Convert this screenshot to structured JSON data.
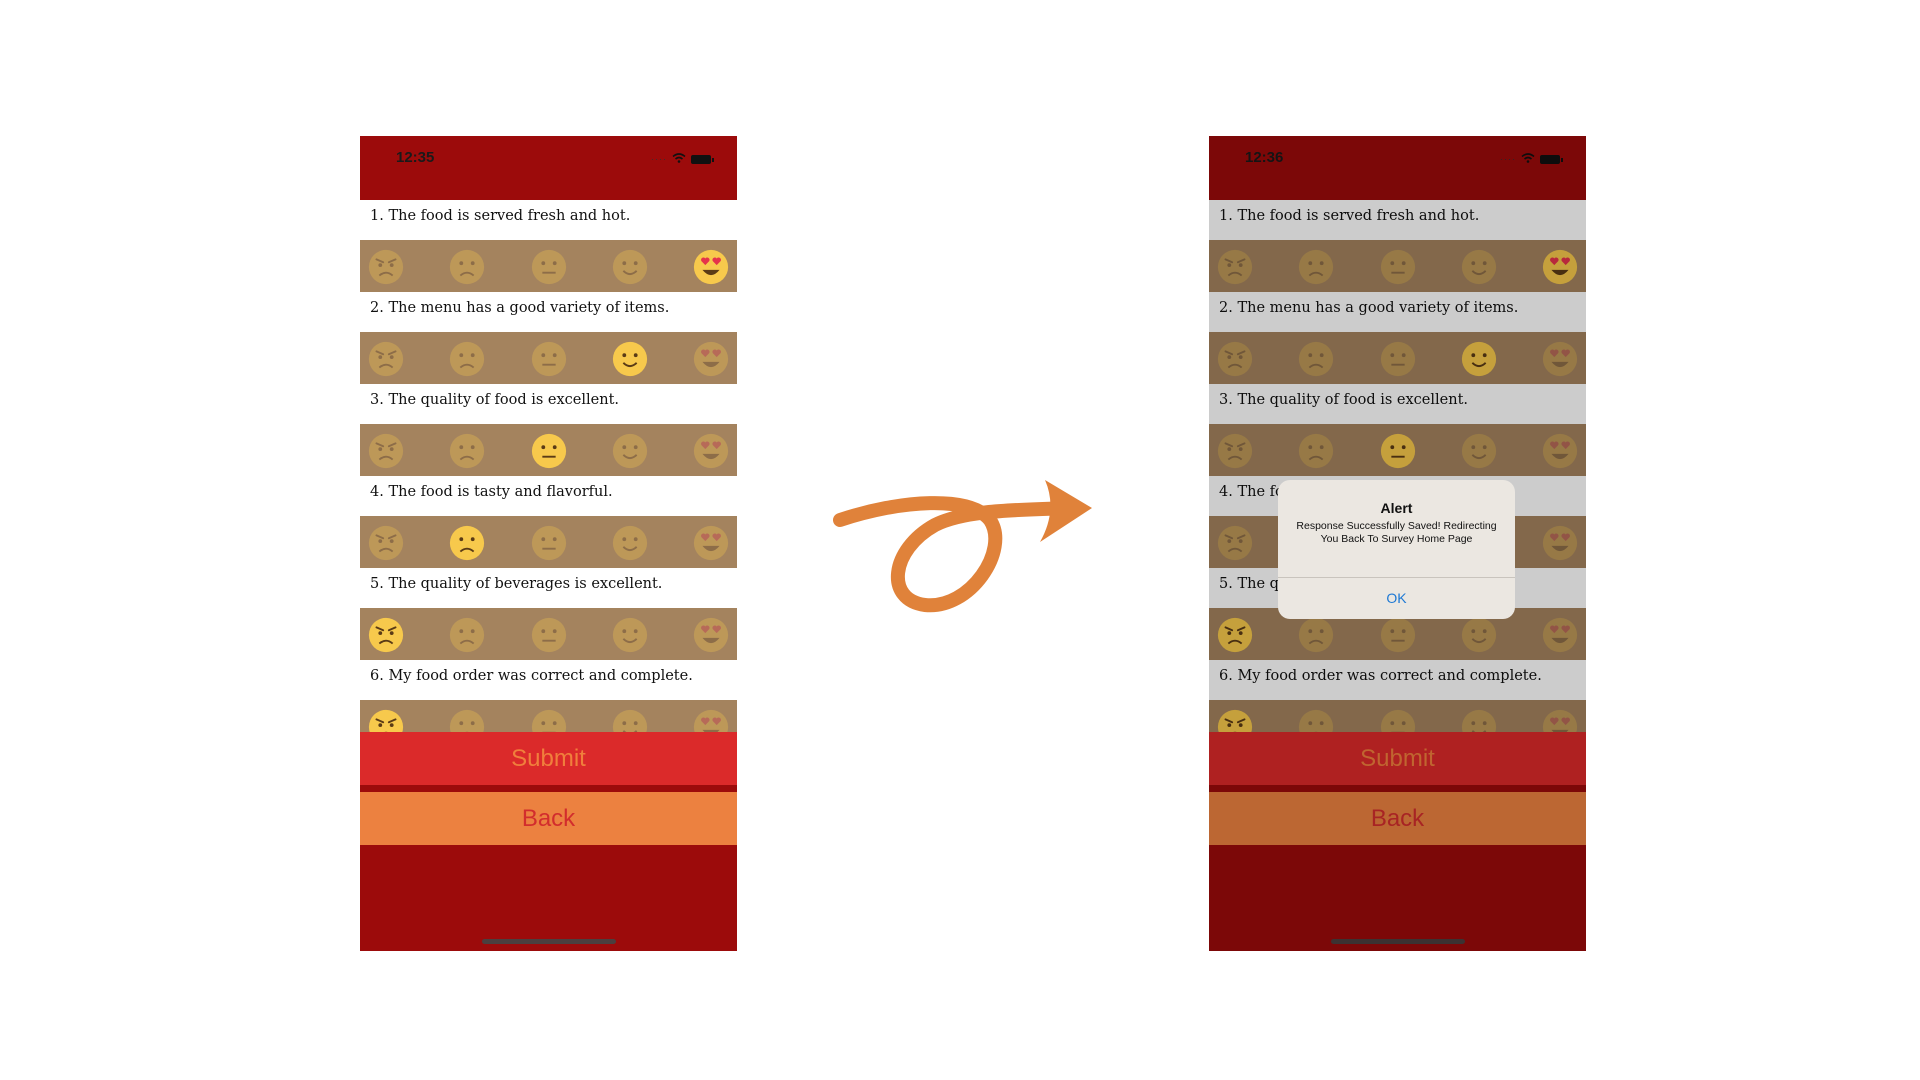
{
  "colors": {
    "header_red": "#9c0b0b",
    "emoji_row": "#a4835e",
    "submit_bg": "#db2a2a",
    "submit_text": "#f07f3c",
    "back_bg": "#ec8140",
    "back_text": "#d22d2d",
    "arrow": "#e0823a",
    "alert_ok": "#1e79d4"
  },
  "screens": [
    {
      "status_time": "12:35",
      "status_icons": [
        "cellular-dots-icon",
        "wifi-icon",
        "battery-icon"
      ],
      "questions": [
        {
          "label": "1. The food is served fresh and hot.",
          "selected": 5
        },
        {
          "label": "2. The menu has a good variety of items.",
          "selected": 4
        },
        {
          "label": "3. The quality of food is excellent.",
          "selected": 3
        },
        {
          "label": "4. The food is tasty and flavorful.",
          "selected": 2
        },
        {
          "label": "5. The quality of beverages is excellent.",
          "selected": 1
        },
        {
          "label": "6. My food order was correct and complete.",
          "selected": 1
        }
      ],
      "submit_label": "Submit",
      "back_label": "Back"
    },
    {
      "status_time": "12:36",
      "status_icons": [
        "cellular-dots-icon",
        "wifi-icon",
        "battery-icon"
      ],
      "questions": [
        {
          "label": "1. The food is served fresh and hot.",
          "selected": 5
        },
        {
          "label": "2. The menu has a good variety of items.",
          "selected": 4
        },
        {
          "label": "3. The quality of food is excellent.",
          "selected": 3
        },
        {
          "label": "4. The food is tasty and flavorful.",
          "selected": 2
        },
        {
          "label": "5. The quality of beverages is excellent.",
          "selected": 1
        },
        {
          "label": "6. My food order was correct and complete.",
          "selected": 1
        }
      ],
      "submit_label": "Submit",
      "back_label": "Back",
      "alert": {
        "title": "Alert",
        "message": "Response Successfully Saved! Redirecting You Back To Survey Home Page",
        "ok_label": "OK"
      }
    }
  ],
  "emoji_scale": [
    "angry-face-icon",
    "frowning-face-icon",
    "neutral-face-icon",
    "smiling-face-icon",
    "heart-eyes-face-icon"
  ],
  "arrow_icon": "curly-arrow-icon"
}
